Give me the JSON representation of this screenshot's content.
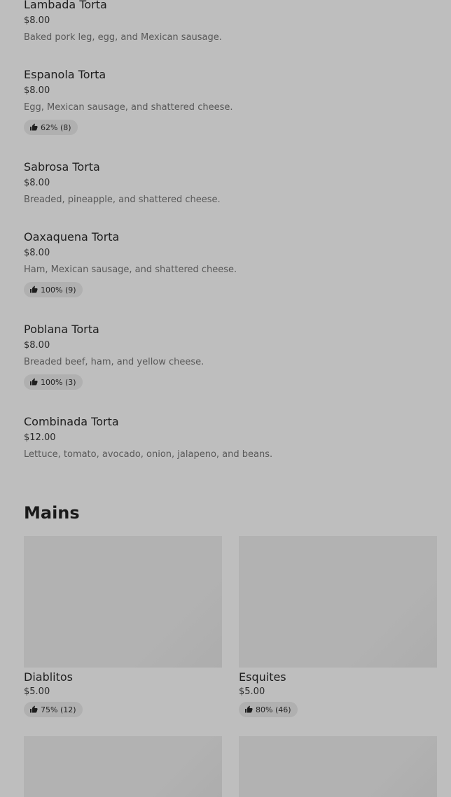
{
  "menu_items": [
    {
      "title": "Lambada Torta",
      "price": "$8.00",
      "description": "Baked pork leg, egg, and Mexican sausage.",
      "rating": ""
    },
    {
      "title": "Espanola Torta",
      "price": "$8.00",
      "description": "Egg, Mexican sausage, and shattered cheese.",
      "rating": "62% (8)"
    },
    {
      "title": "Sabrosa Torta",
      "price": "$8.00",
      "description": "Breaded, pineapple, and shattered cheese.",
      "rating": ""
    },
    {
      "title": "Oaxaquena Torta",
      "price": "$8.00",
      "description": "Ham, Mexican sausage, and shattered cheese.",
      "rating": "100% (9)"
    },
    {
      "title": "Poblana Torta",
      "price": "$8.00",
      "description": "Breaded beef, ham, and yellow cheese.",
      "rating": "100% (3)"
    },
    {
      "title": "Combinada Torta",
      "price": "$12.00",
      "description": "Lettuce, tomato, avocado, onion, jalapeno, and beans.",
      "rating": ""
    }
  ],
  "mains": {
    "heading": "Mains",
    "cards": [
      {
        "title": "Diablitos",
        "price": "$5.00",
        "rating": "75% (12)"
      },
      {
        "title": "Esquites",
        "price": "$5.00",
        "rating": "80% (46)"
      }
    ]
  },
  "icons": {
    "rating": "thumbs-up-icon"
  },
  "colors": {
    "background": "#bebebe",
    "image_placeholder": "#b2b2b2",
    "rating_pill": "#b0b0b0"
  }
}
